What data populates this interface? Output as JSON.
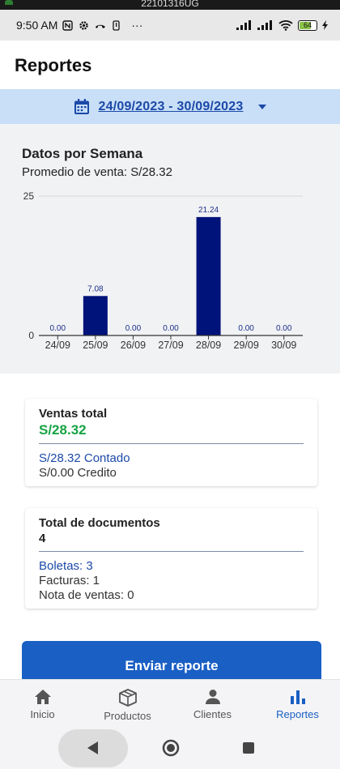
{
  "status_bar": {
    "top_label": "22101316UG",
    "time": "9:50 AM",
    "battery": "64",
    "more": "···"
  },
  "header": {
    "title": "Reportes"
  },
  "date_range": "24/09/2023 - 30/09/2023",
  "chart_section": {
    "title": "Datos por Semana",
    "subtitle": "Promedio de venta: S/28.32"
  },
  "chart_data": {
    "type": "bar",
    "categories": [
      "24/09",
      "25/09",
      "26/09",
      "27/09",
      "28/09",
      "29/09",
      "30/09"
    ],
    "values": [
      0.0,
      7.08,
      0.0,
      0.0,
      21.24,
      0.0,
      0.0
    ],
    "value_labels": [
      "0.00",
      "7.08",
      "0.00",
      "0.00",
      "21.24",
      "0.00",
      "0.00"
    ],
    "y_ticks": [
      "25",
      "0"
    ],
    "ylim": [
      0,
      25
    ],
    "bar_color": "#00137a",
    "label_color": "#1b2f8a",
    "grid": true
  },
  "sales_card": {
    "title": "Ventas total",
    "total": "S/28.32",
    "contado": "S/28.32 Contado",
    "credito": "S/0.00 Credito",
    "total_color": "#17a344"
  },
  "docs_card": {
    "title": "Total de documentos",
    "total": "4",
    "boletas": "Boletas: 3",
    "facturas": "Facturas: 1",
    "notas": "Nota de ventas: 0"
  },
  "send_button": "Enviar reporte",
  "bottom_nav": [
    {
      "label": "Inicio",
      "icon": "home-icon",
      "active": false
    },
    {
      "label": "Productos",
      "icon": "box-icon",
      "active": false
    },
    {
      "label": "Clientes",
      "icon": "person-icon",
      "active": false
    },
    {
      "label": "Reportes",
      "icon": "bar-chart-icon",
      "active": true
    }
  ],
  "colors": {
    "accent": "#1a5fc4",
    "date_bar": "#c9dff7",
    "link": "#1b49a8"
  }
}
